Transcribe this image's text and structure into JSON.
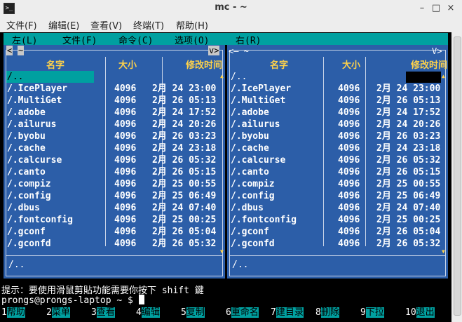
{
  "window": {
    "title": "mc - ~",
    "app_icon": ">_",
    "minimize": "–",
    "maximize": "□",
    "close": "×"
  },
  "menubar": [
    "文件(F)",
    "编辑(E)",
    "查看(V)",
    "终端(T)",
    "帮助(H)"
  ],
  "mc_menu": [
    "左(L)",
    "文件(F)",
    "命令(C)",
    "选项(O)",
    "右(R)"
  ],
  "left_panel": {
    "path": "~",
    "corner_left": "<",
    "corner_right": "v>",
    "headers": {
      "name": "名字",
      "size": "大小",
      "mtime": "修改时间"
    },
    "updir": "/..",
    "minibar": "/..",
    "rows": [
      {
        "name": "/.IcePlayer",
        "size": "4096",
        "date": "2月 24 23:00"
      },
      {
        "name": "/.MultiGet",
        "size": "4096",
        "date": "2月 26 05:13"
      },
      {
        "name": "/.adobe",
        "size": "4096",
        "date": "2月 24 17:52"
      },
      {
        "name": "/.ailurus",
        "size": "4096",
        "date": "2月 24 20:26"
      },
      {
        "name": "/.byobu",
        "size": "4096",
        "date": "2月 26 03:23"
      },
      {
        "name": "/.cache",
        "size": "4096",
        "date": "2月 24 23:18"
      },
      {
        "name": "/.calcurse",
        "size": "4096",
        "date": "2月 26 05:32"
      },
      {
        "name": "/.canto",
        "size": "4096",
        "date": "2月 26 05:15"
      },
      {
        "name": "/.compiz",
        "size": "4096",
        "date": "2月 25 00:55"
      },
      {
        "name": "/.config",
        "size": "4096",
        "date": "2月 25 06:49"
      },
      {
        "name": "/.dbus",
        "size": "4096",
        "date": "2月 24 07:40"
      },
      {
        "name": "/.fontconfig",
        "size": "4096",
        "date": "2月 25 00:25"
      },
      {
        "name": "/.gconf",
        "size": "4096",
        "date": "2月 26 05:04"
      },
      {
        "name": "/.gconfd",
        "size": "4096",
        "date": "2月 26 05:32"
      }
    ]
  },
  "right_panel": {
    "path_label": "<— ~",
    "corner_right": "V>",
    "headers": {
      "name": "名字",
      "size": "大小",
      "mtime": "修改时间"
    },
    "updir": "/..",
    "minibar": "/..",
    "rows": [
      {
        "name": "/.IcePlayer",
        "size": "4096",
        "date": "2月 24 23:00"
      },
      {
        "name": "/.MultiGet",
        "size": "4096",
        "date": "2月 26 05:13"
      },
      {
        "name": "/.adobe",
        "size": "4096",
        "date": "2月 24 17:52"
      },
      {
        "name": "/.ailurus",
        "size": "4096",
        "date": "2月 24 20:26"
      },
      {
        "name": "/.byobu",
        "size": "4096",
        "date": "2月 26 03:23"
      },
      {
        "name": "/.cache",
        "size": "4096",
        "date": "2月 24 23:18"
      },
      {
        "name": "/.calcurse",
        "size": "4096",
        "date": "2月 26 05:32"
      },
      {
        "name": "/.canto",
        "size": "4096",
        "date": "2月 26 05:15"
      },
      {
        "name": "/.compiz",
        "size": "4096",
        "date": "2月 25 00:55"
      },
      {
        "name": "/.config",
        "size": "4096",
        "date": "2月 25 06:49"
      },
      {
        "name": "/.dbus",
        "size": "4096",
        "date": "2月 24 07:40"
      },
      {
        "name": "/.fontconfig",
        "size": "4096",
        "date": "2月 25 00:25"
      },
      {
        "name": "/.gconf",
        "size": "4096",
        "date": "2月 26 05:04"
      },
      {
        "name": "/.gconfd",
        "size": "4096",
        "date": "2月 26 05:32"
      }
    ]
  },
  "hint": "提示：要使用滑鼠剪貼功能需要你按下 shift 鍵",
  "prompt": "prongs@prongs-laptop ~ $ ",
  "fkeys": [
    {
      "n": "1",
      "label": "帮助"
    },
    {
      "n": "2",
      "label": "菜单"
    },
    {
      "n": "3",
      "label": "查看"
    },
    {
      "n": "4",
      "label": "编辑"
    },
    {
      "n": "5",
      "label": "复制"
    },
    {
      "n": "6",
      "label": "重命名"
    },
    {
      "n": "7",
      "label": "建目录"
    },
    {
      "n": "8",
      "label": "删除"
    },
    {
      "n": "9",
      "label": "下拉"
    },
    {
      "n": "10",
      "label": "退出"
    }
  ],
  "colors": {
    "panel_bg": "#2c5ea8",
    "accent": "#00a0a0",
    "header": "#ffd24a"
  }
}
